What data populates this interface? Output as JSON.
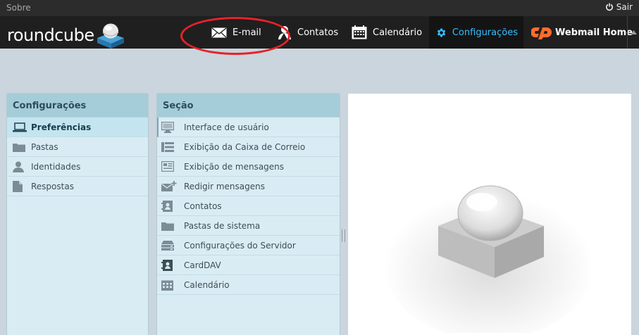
{
  "topline": {
    "about": "Sobre",
    "logout": "Sair"
  },
  "header": {
    "logo_text": "roundcube"
  },
  "nav": [
    {
      "label": "E-mail",
      "icon": "envelope-icon"
    },
    {
      "label": "Contatos",
      "icon": "contacts-icon"
    },
    {
      "label": "Calendário",
      "icon": "calendar-icon"
    },
    {
      "label": "Configurações",
      "icon": "gear-icon",
      "active": true
    },
    {
      "label": "Webmail Home",
      "icon": "cpanel-icon"
    }
  ],
  "settings": {
    "title": "Configurações",
    "items": [
      {
        "label": "Preferências",
        "icon": "laptop-icon",
        "selected": true
      },
      {
        "label": "Pastas",
        "icon": "folder-icon"
      },
      {
        "label": "Identidades",
        "icon": "person-icon"
      },
      {
        "label": "Respostas",
        "icon": "document-icon"
      }
    ]
  },
  "section": {
    "title": "Seção",
    "items": [
      {
        "label": "Interface de usuário",
        "icon": "monitor-icon"
      },
      {
        "label": "Exibição da Caixa de Correio",
        "icon": "mailbox-view-icon"
      },
      {
        "label": "Exibição de mensagens",
        "icon": "message-view-icon"
      },
      {
        "label": "Redigir mensagens",
        "icon": "compose-icon"
      },
      {
        "label": "Contatos",
        "icon": "addressbook-icon"
      },
      {
        "label": "Pastas de sistema",
        "icon": "folder-icon"
      },
      {
        "label": "Configurações do Servidor",
        "icon": "server-icon"
      },
      {
        "label": "CardDAV",
        "icon": "carddav-icon"
      },
      {
        "label": "Calendário",
        "icon": "calendar-icon"
      }
    ]
  },
  "colors": {
    "accent": "#37beff",
    "annotation": "#e8212b",
    "header_bg": "#1f1f1f",
    "panel_bg": "#d9ecf4",
    "panel_title_bg": "#a5cdd9"
  }
}
